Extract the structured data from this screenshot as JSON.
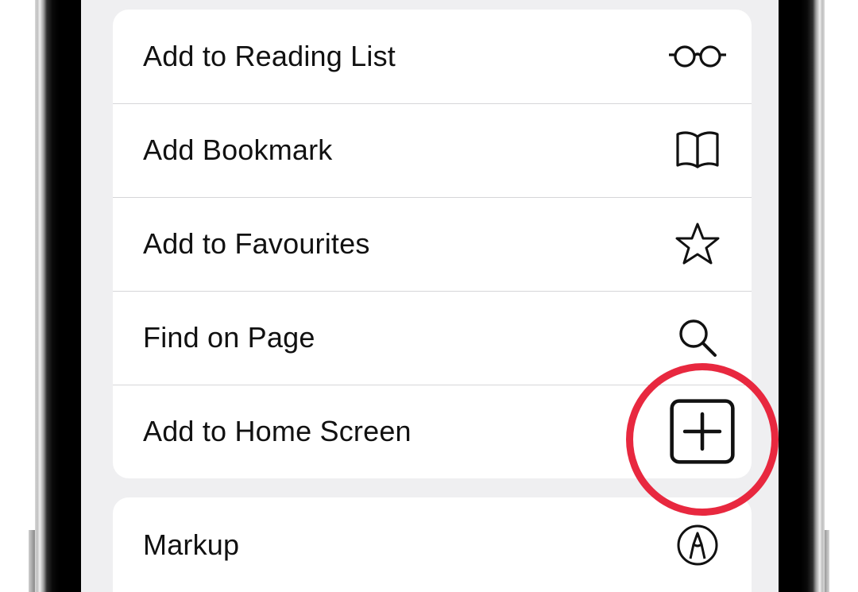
{
  "share_sheet": {
    "actions": [
      {
        "label": "Add to Reading List",
        "icon": "glasses-icon"
      },
      {
        "label": "Add Bookmark",
        "icon": "open-book-icon"
      },
      {
        "label": "Add to Favourites",
        "icon": "star-icon"
      },
      {
        "label": "Find on Page",
        "icon": "magnifying-glass-icon"
      },
      {
        "label": "Add to Home Screen",
        "icon": "plus-square-icon"
      }
    ],
    "more_actions": [
      {
        "label": "Markup",
        "icon": "pen-tip-circle-icon"
      }
    ]
  },
  "colors": {
    "sheet_background": "#efeff1",
    "row_background": "#ffffff",
    "separator": "#d6d6d8",
    "text": "#111111",
    "highlight": "#e8283f"
  }
}
